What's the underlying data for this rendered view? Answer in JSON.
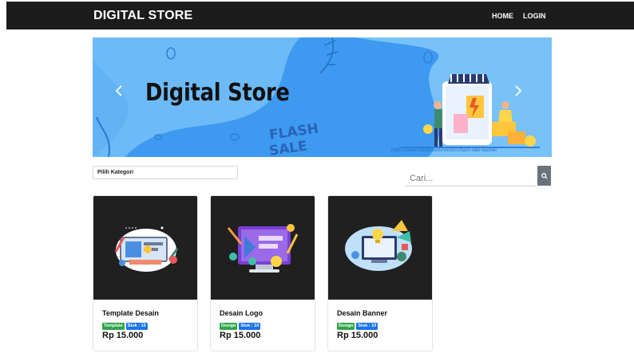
{
  "navbar": {
    "brand": "DIGITAL STORE",
    "links": [
      "HOME",
      "LOGIN"
    ]
  },
  "banner": {
    "title": "Digital Store",
    "flash_sale_text": "FLASH SALE",
    "credit_text": "https://www.freepik.com/vectors/flash-sale-banner",
    "prev_icon": "chevron-left-icon",
    "next_icon": "chevron-right-icon"
  },
  "filters": {
    "category_placeholder": "Pilih Kategori",
    "search_placeholder": "Cari...",
    "search_icon": "search-icon"
  },
  "products": [
    {
      "title": "Template Desain",
      "category": "Template",
      "stock": "Stok : 10",
      "price": "Rp 15.000"
    },
    {
      "title": "Desain Logo",
      "category": "Design",
      "stock": "Stok : 10",
      "price": "Rp 15.000"
    },
    {
      "title": "Desain Banner",
      "category": "Design",
      "stock": "Stok : 10",
      "price": "Rp 15.000"
    }
  ],
  "colors": {
    "navbar_bg": "#1c1c1c",
    "banner_bg": "#3d9af0",
    "category_badge": "#2fa54a",
    "stock_badge": "#1a73e8",
    "search_button": "#68737c"
  }
}
